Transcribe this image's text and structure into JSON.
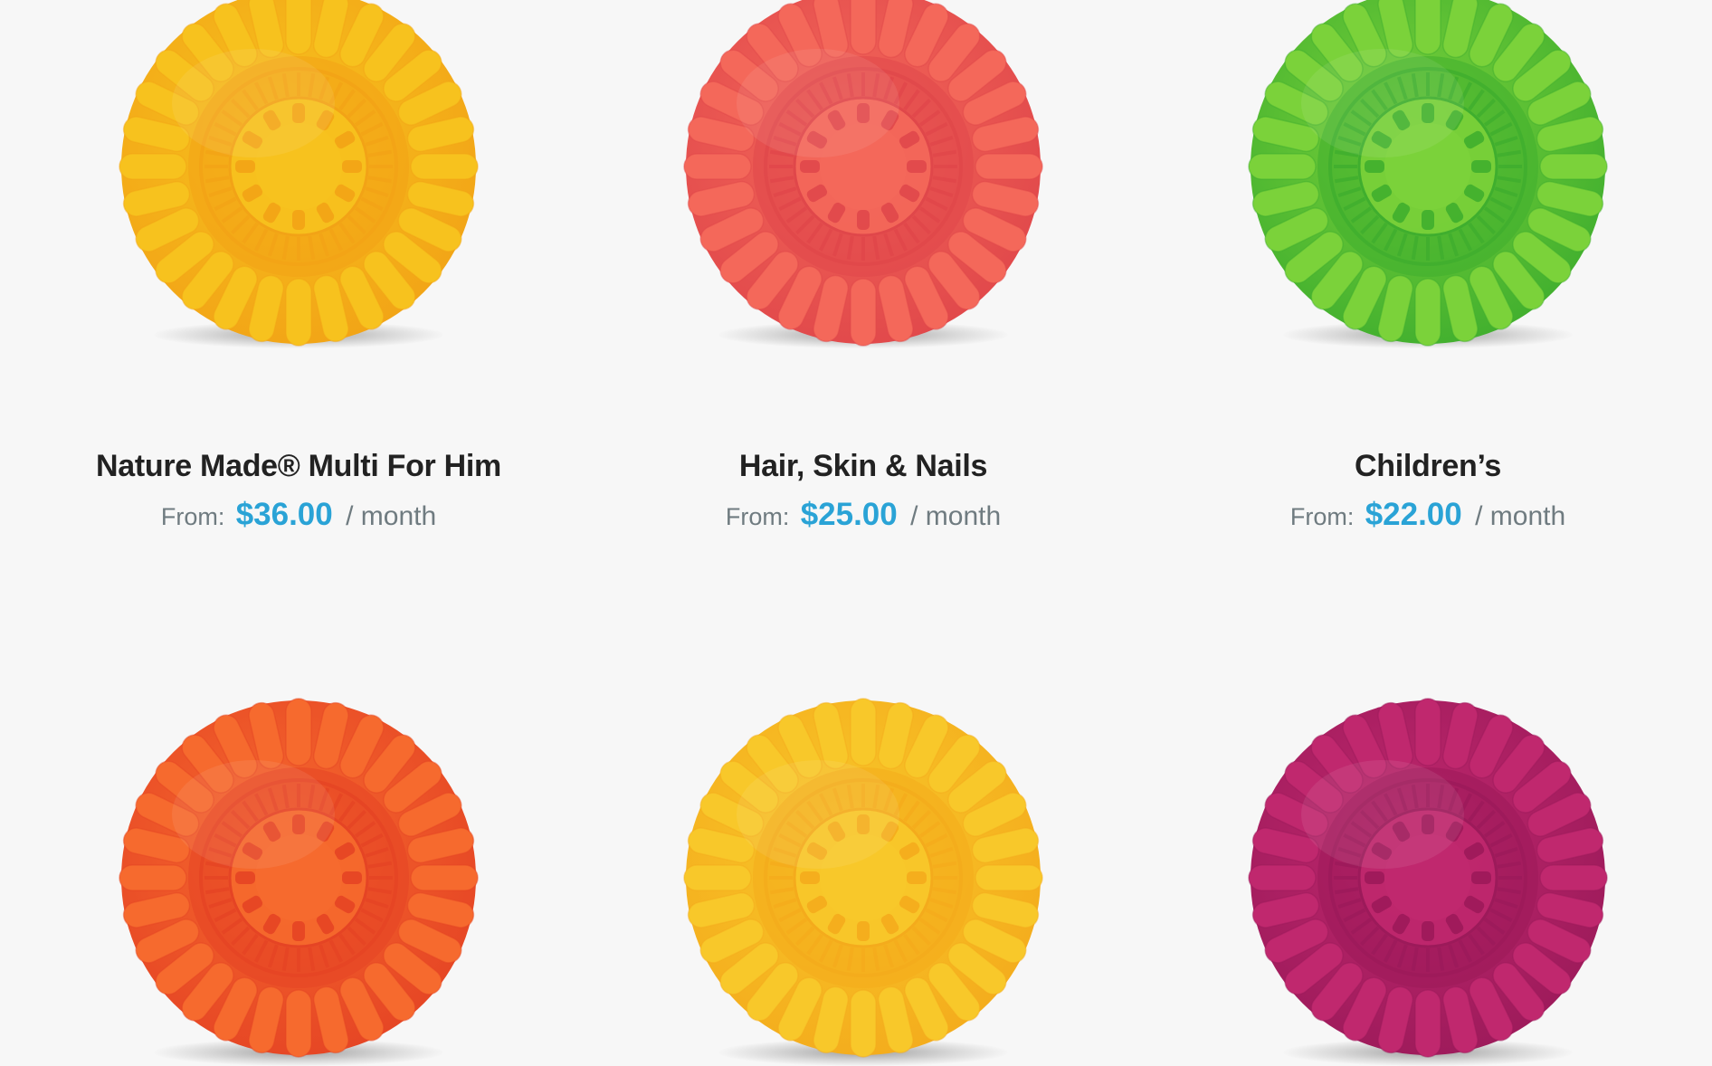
{
  "products": [
    {
      "name": "Nature Made® Multi For Him",
      "price": {
        "prefix": "From:",
        "amount": "$36.00",
        "period": "/ month"
      },
      "color": "#f7c21e",
      "deep": "#f2a316",
      "icon": "vitamin-pack-icon"
    },
    {
      "name": "Hair, Skin & Nails",
      "price": {
        "prefix": "From:",
        "amount": "$25.00",
        "period": "/ month"
      },
      "color": "#f4685a",
      "deep": "#e0474a",
      "icon": "vitamin-pack-icon"
    },
    {
      "name": "Children’s",
      "price": {
        "prefix": "From:",
        "amount": "$22.00",
        "period": "/ month"
      },
      "color": "#7bd23a",
      "deep": "#3fae2e",
      "icon": "vitamin-pack-icon"
    },
    {
      "color": "#f66a2e",
      "deep": "#e54424",
      "icon": "vitamin-pack-icon"
    },
    {
      "color": "#f8c82a",
      "deep": "#f4ab1c",
      "icon": "vitamin-pack-icon"
    },
    {
      "color": "#c0286e",
      "deep": "#9c1a5a",
      "icon": "vitamin-pack-icon"
    }
  ]
}
